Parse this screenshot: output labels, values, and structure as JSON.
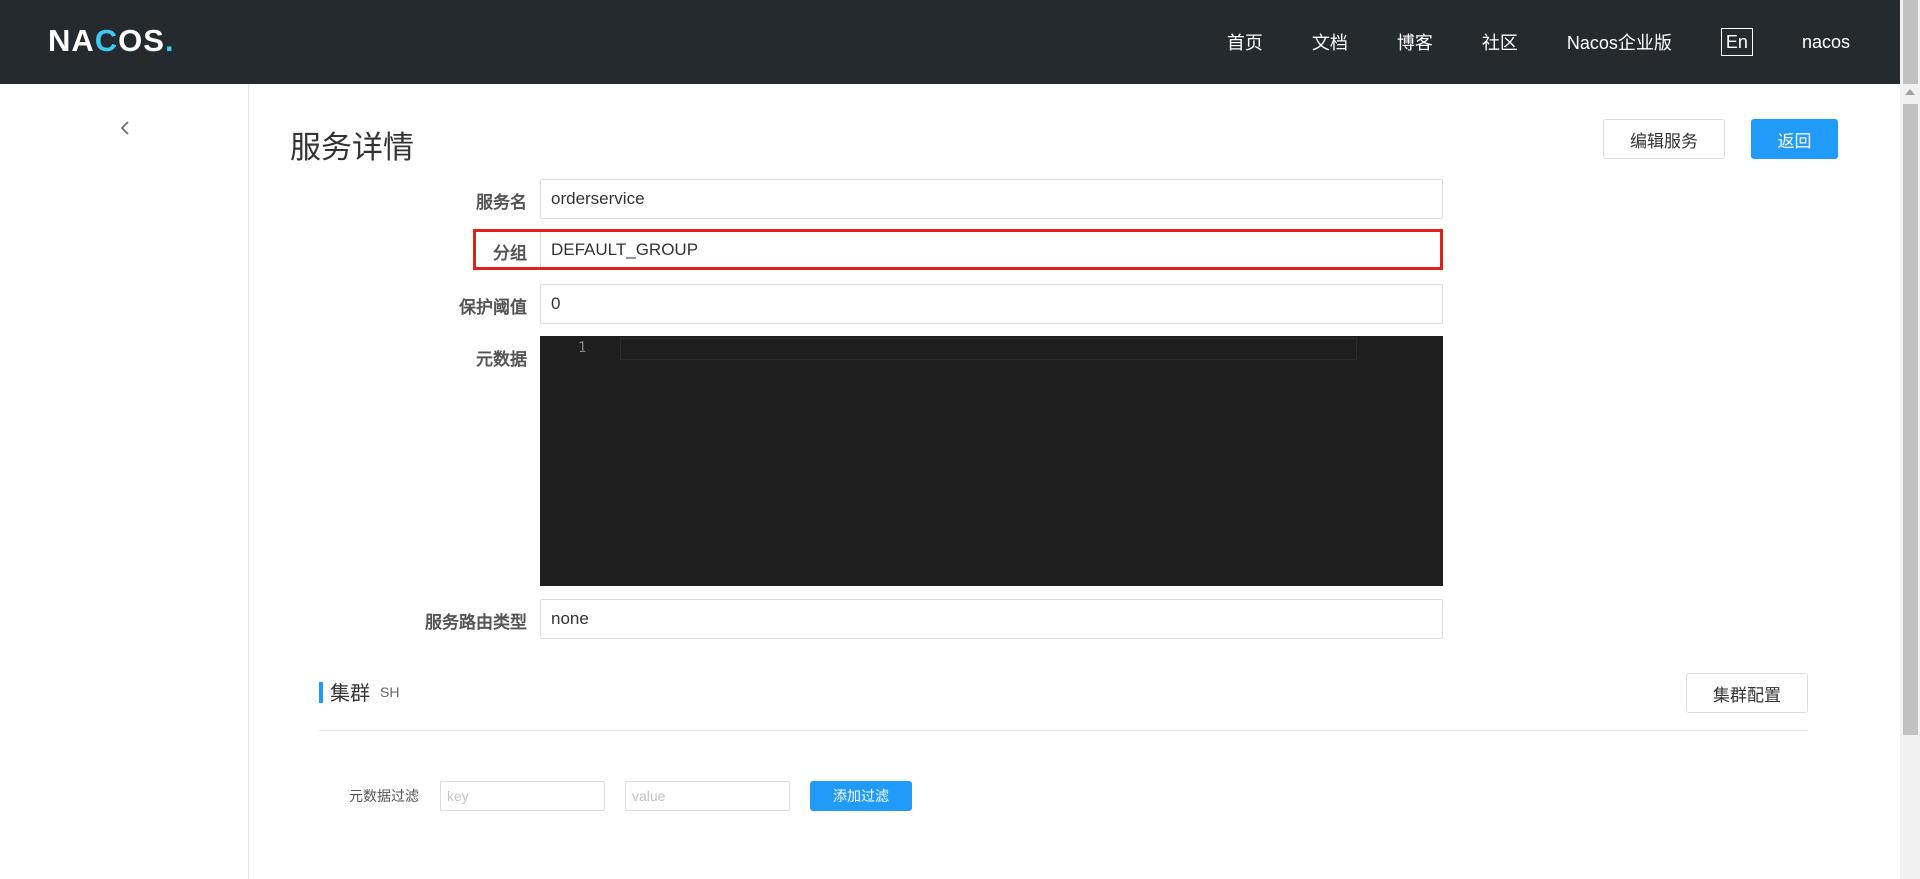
{
  "header": {
    "logo": "NACOS.",
    "nav": [
      "首页",
      "文档",
      "博客",
      "社区",
      "Nacos企业版"
    ],
    "lang": "En",
    "user": "nacos"
  },
  "page": {
    "title": "服务详情",
    "edit_button": "编辑服务",
    "back_button": "返回"
  },
  "form": {
    "service_name": {
      "label": "服务名",
      "value": "orderservice"
    },
    "group": {
      "label": "分组",
      "value": "DEFAULT_GROUP"
    },
    "protect_threshold": {
      "label": "保护阈值",
      "value": "0"
    },
    "metadata": {
      "label": "元数据",
      "line_number": "1"
    },
    "selector_type": {
      "label": "服务路由类型",
      "value": "none"
    }
  },
  "cluster": {
    "title": "集群",
    "name": "SH",
    "config_button": "集群配置",
    "filter_label": "元数据过滤",
    "key_placeholder": "key",
    "value_placeholder": "value",
    "add_filter_button": "添加过滤"
  },
  "colors": {
    "header_bg": "#252a2f",
    "logo_accent": "#3fc9f3",
    "primary": "#209bfa",
    "highlight": "#e0201b",
    "editor_bg": "#1e1e1e"
  },
  "icons": {
    "sidebar_toggle": "chevron-left-icon"
  }
}
